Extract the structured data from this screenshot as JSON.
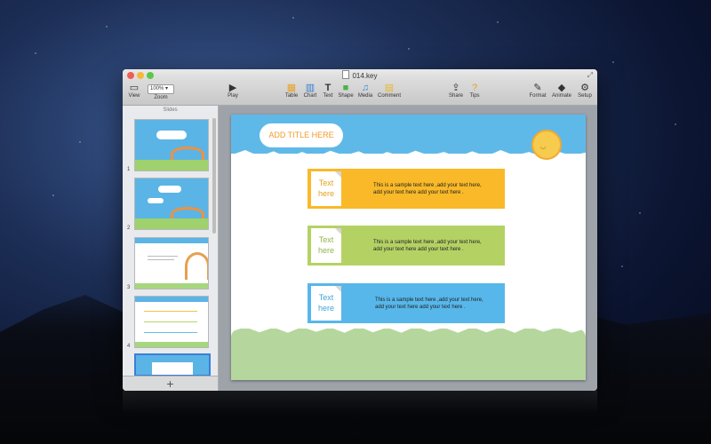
{
  "window": {
    "title": "014.key"
  },
  "toolbar": {
    "view": "View",
    "zoom_value": "100%",
    "zoom": "Zoom",
    "play": "Play",
    "table": "Table",
    "chart": "Chart",
    "text": "Text",
    "shape": "Shape",
    "media": "Media",
    "comment": "Comment",
    "share": "Share",
    "tips": "Tips",
    "format": "Format",
    "animate": "Animate",
    "setup": "Setup"
  },
  "sidebar": {
    "header": "Slides",
    "thumb_numbers": [
      "1",
      "2",
      "3",
      "4"
    ],
    "add": "+"
  },
  "slide": {
    "title": "ADD TITLE HERE",
    "items": [
      {
        "label1": "Text",
        "label2": "here",
        "line1": "This is a sample text here ,add your text here,",
        "line2": "add your text here add your text here ."
      },
      {
        "label1": "Text",
        "label2": "here",
        "line1": "This is a sample text here ,add your text here,",
        "line2": "add your text here add your text here ."
      },
      {
        "label1": "Text",
        "label2": "here",
        "line1": "This is a sample text here ,add your text here,",
        "line2": "add your text here add your text here ."
      }
    ]
  },
  "colors": {
    "yellow_bar": "#f9b928",
    "green_bar": "#b4d264",
    "blue_bar": "#57b7ea",
    "title_orange": "#f39a2a"
  }
}
